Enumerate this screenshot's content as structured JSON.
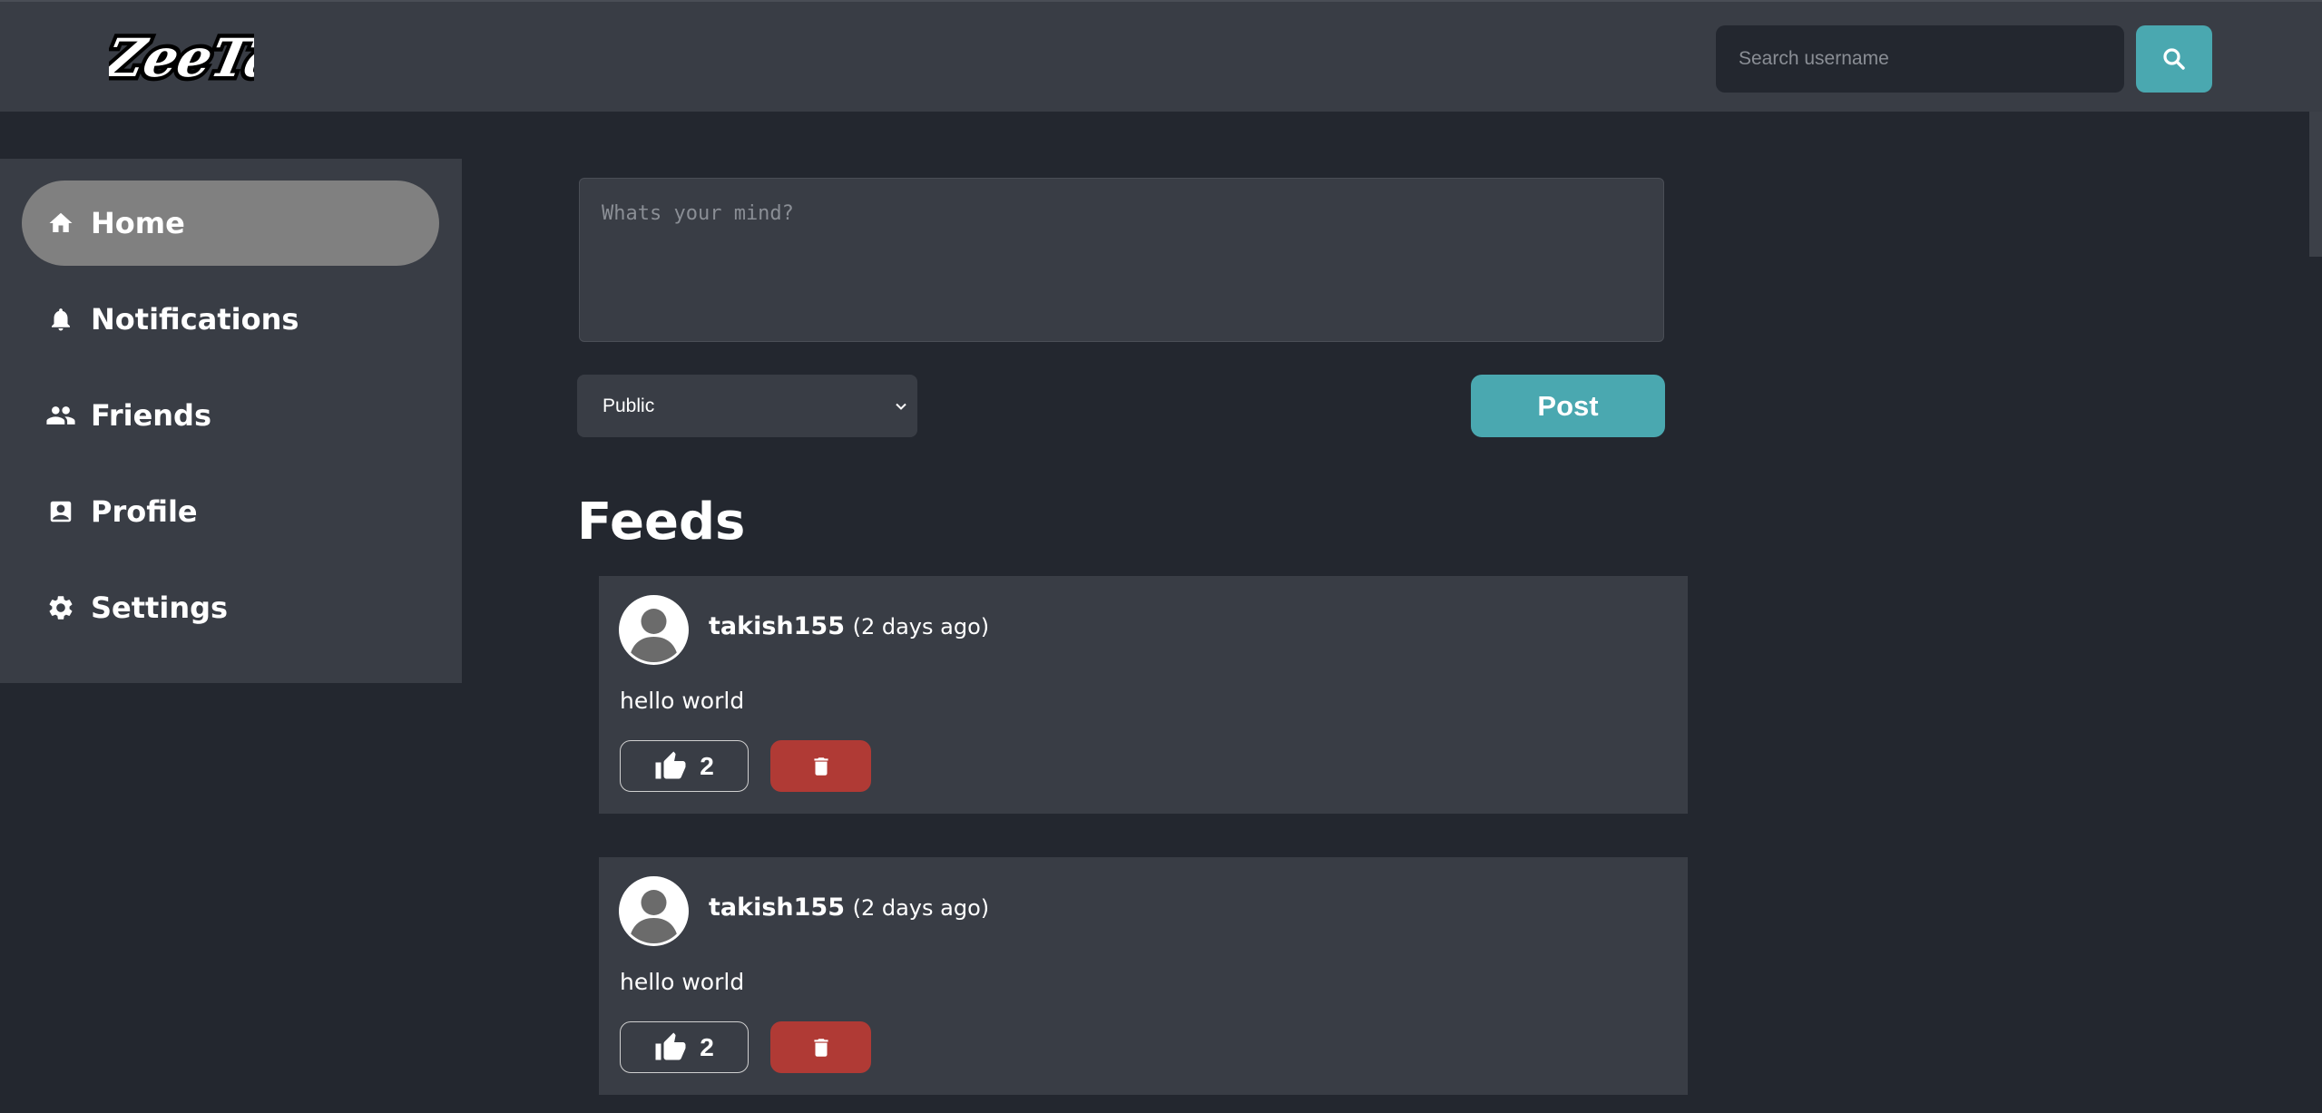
{
  "header": {
    "logo_text": "ZeeTaa",
    "search_placeholder": "Search username",
    "search_icon": "search-icon"
  },
  "sidebar": {
    "items": [
      {
        "label": "Home",
        "icon": "home-icon",
        "active": true
      },
      {
        "label": "Notifications",
        "icon": "bell-icon",
        "active": false
      },
      {
        "label": "Friends",
        "icon": "people-icon",
        "active": false
      },
      {
        "label": "Profile",
        "icon": "profile-card-icon",
        "active": false
      },
      {
        "label": "Settings",
        "icon": "gear-icon",
        "active": false
      }
    ]
  },
  "composer": {
    "placeholder": "Whats your mind?",
    "visibility_value": "Public",
    "post_label": "Post"
  },
  "feeds": {
    "title": "Feeds",
    "posts": [
      {
        "author": "takish155",
        "time": "(2 days ago)",
        "body": "hello world",
        "likes": "2"
      },
      {
        "author": "takish155",
        "time": "(2 days ago)",
        "body": "hello world",
        "likes": "2"
      }
    ]
  },
  "colors": {
    "background": "#23272f",
    "panel": "#393d45",
    "accent": "#4aa8b0",
    "danger": "#b03a35",
    "active_nav": "#808080"
  }
}
